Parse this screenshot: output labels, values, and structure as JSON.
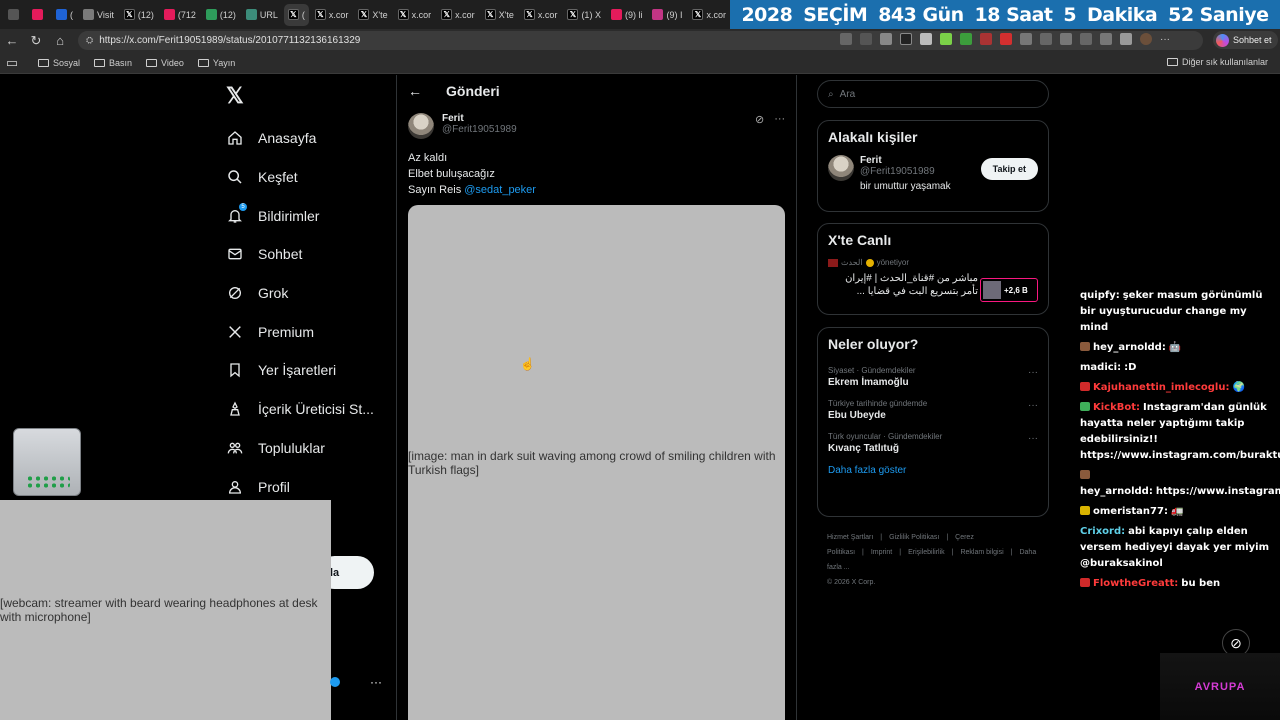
{
  "browser": {
    "tabs": [
      {
        "label": "",
        "icon_color": "#555555",
        "active": false
      },
      {
        "label": "",
        "icon_color": "#e41b5b",
        "active": false
      },
      {
        "label": "(",
        "icon_color": "#1f63d6",
        "active": false
      },
      {
        "label": "Visit",
        "icon_color": "#7a7a7a",
        "active": false
      },
      {
        "label": "(12)",
        "icon_color": "#000000",
        "active": false
      },
      {
        "label": "(712",
        "icon_color": "#e41b5b",
        "active": false
      },
      {
        "label": "(12)",
        "icon_color": "#2e9c5b",
        "active": false
      },
      {
        "label": "URL",
        "icon_color": "#3c8c7a",
        "active": false
      },
      {
        "label": "(",
        "icon_color": "#000000",
        "active": true
      },
      {
        "label": "x.cor",
        "icon_color": "#000000",
        "active": false
      },
      {
        "label": "X'te",
        "icon_color": "#000000",
        "active": false
      },
      {
        "label": "x.cor",
        "icon_color": "#000000",
        "active": false
      },
      {
        "label": "x.cor",
        "icon_color": "#000000",
        "active": false
      },
      {
        "label": "X'te",
        "icon_color": "#000000",
        "active": false
      },
      {
        "label": "x.cor",
        "icon_color": "#000000",
        "active": false
      },
      {
        "label": "(1) X",
        "icon_color": "#000000",
        "active": false
      },
      {
        "label": "(9) li",
        "icon_color": "#e41b5b",
        "active": false
      },
      {
        "label": "(9) I",
        "icon_color": "#c13584",
        "active": false
      },
      {
        "label": "x.cor",
        "icon_color": "#000000",
        "active": false
      },
      {
        "label": "",
        "icon_color": "#000000",
        "active": false
      }
    ],
    "banner": [
      "2028",
      "SEÇİM",
      "843 Gün",
      "18 Saat",
      "5",
      "Dakika",
      "52 Saniye"
    ],
    "url": "https://x.com/Ferit19051989/status/2010771132136161329",
    "chat_button": "Sohbet et",
    "bookmarks": [
      "Sosyal",
      "Basın",
      "Video",
      "Yayın"
    ],
    "other_bookmarks": "Diğer sık kullanılanlar"
  },
  "nav": {
    "items": [
      {
        "label": "Anasayfa",
        "icon": "home-icon"
      },
      {
        "label": "Keşfet",
        "icon": "search-icon"
      },
      {
        "label": "Bildirimler",
        "icon": "bell-icon"
      },
      {
        "label": "Sohbet",
        "icon": "mail-icon"
      },
      {
        "label": "Grok",
        "icon": "grok-icon"
      },
      {
        "label": "Premium",
        "icon": "x-premium-icon"
      },
      {
        "label": "Yer İşaretleri",
        "icon": "bookmark-icon"
      },
      {
        "label": "İçerik Üreticisi St...",
        "icon": "creator-studio-icon"
      },
      {
        "label": "Topluluklar",
        "icon": "communities-icon"
      },
      {
        "label": "Profil",
        "icon": "profile-icon"
      }
    ],
    "notif_count": "5",
    "post_button_fragment": "la"
  },
  "post": {
    "header": "Gönderi",
    "author_name": "Ferit",
    "author_handle": "@Ferit19051989",
    "lines": [
      "Az kaldı",
      "Elbet buluşacağız",
      "Sayın Reis "
    ],
    "mention": "@sedat_peker",
    "image_label": "[image: man in dark suit waving among crowd of smiling children with Turkish flags]"
  },
  "sidebar": {
    "search_placeholder": "Ara",
    "related": {
      "title": "Alakalı kişiler",
      "name": "Ferit",
      "handle": "@Ferit19051989",
      "bio": "bir umuttur yaşamak",
      "follow_label": "Takip et"
    },
    "live": {
      "title": "X'te Canlı",
      "channel": "الحدث",
      "role": "yönetiyor",
      "text": "مباشر من #قناة_الحدث | #إيران تأمر بتسريع البت في قضايا ...",
      "count": "+2,6 B"
    },
    "trends": {
      "title": "Neler oluyor?",
      "items": [
        {
          "context": "Siyaset · Gündemdekiler",
          "name": "Ekrem İmamoğlu"
        },
        {
          "context": "Türkiye tarihinde gündemde",
          "name": "Ebu Ubeyde"
        },
        {
          "context": "Türk oyuncular · Gündemdekiler",
          "name": "Kıvanç Tatlıtuğ"
        }
      ],
      "show_more": "Daha fazla göster"
    },
    "footer": {
      "links": [
        "Hizmet Şartları",
        "|",
        "Gizlilik Politikası",
        "|",
        "Çerez Politikası",
        "|",
        "Imprint",
        "|",
        "Erişilebilirlik",
        "|",
        "Reklam bilgisi",
        "|",
        "Daha fazla ..."
      ],
      "copyright": "© 2026 X Corp."
    }
  },
  "chat": [
    {
      "user": "quipfy:",
      "user_color": "#ffffff",
      "badge": "",
      "text": "şeker masum görünümlü bir uyuşturucudur change my mind"
    },
    {
      "user": "hey_arnoldd:",
      "user_color": "#ffffff",
      "badge": "#8a5a3c",
      "text": "🤖"
    },
    {
      "user": "madici:",
      "user_color": "#ffffff",
      "badge": "",
      "text": ":D"
    },
    {
      "user": "Kajuhanettin_imlecoglu:",
      "user_color": "#ff3b3b",
      "badge": "#d12a2a",
      "text": "🌍"
    },
    {
      "user": "KickBot:",
      "user_color": "#ff3b3b",
      "badge": "#3fae5a",
      "text": "Instagram'dan günlük hayatta neler yaptığımı takip edebilirsiniz!! https://www.instagram.com/buraktut/"
    },
    {
      "user": "hey_arnoldd:",
      "user_color": "#ffffff",
      "badge": "#8a5a3c",
      "text": "https://www.instagram.com/reel/DS7gjctjO2R"
    },
    {
      "user": "omeristan77:",
      "user_color": "#ffffff",
      "badge": "#d9b400",
      "text": "🚛"
    },
    {
      "user": "Crixord:",
      "user_color": "#5fd0e8",
      "badge": "",
      "text": "abi kapıyı çalıp elden versem hediyeyi dayak yer miyim @buraksakinol"
    },
    {
      "user": "FlowtheGreatt:",
      "user_color": "#ff3b3b",
      "badge": "#d12a2a",
      "text": "bu ben"
    }
  ],
  "overlay": {
    "webcam_label": "[webcam: streamer with beard wearing headphones at desk with microphone]",
    "corner_logo": "AVRUPA"
  }
}
